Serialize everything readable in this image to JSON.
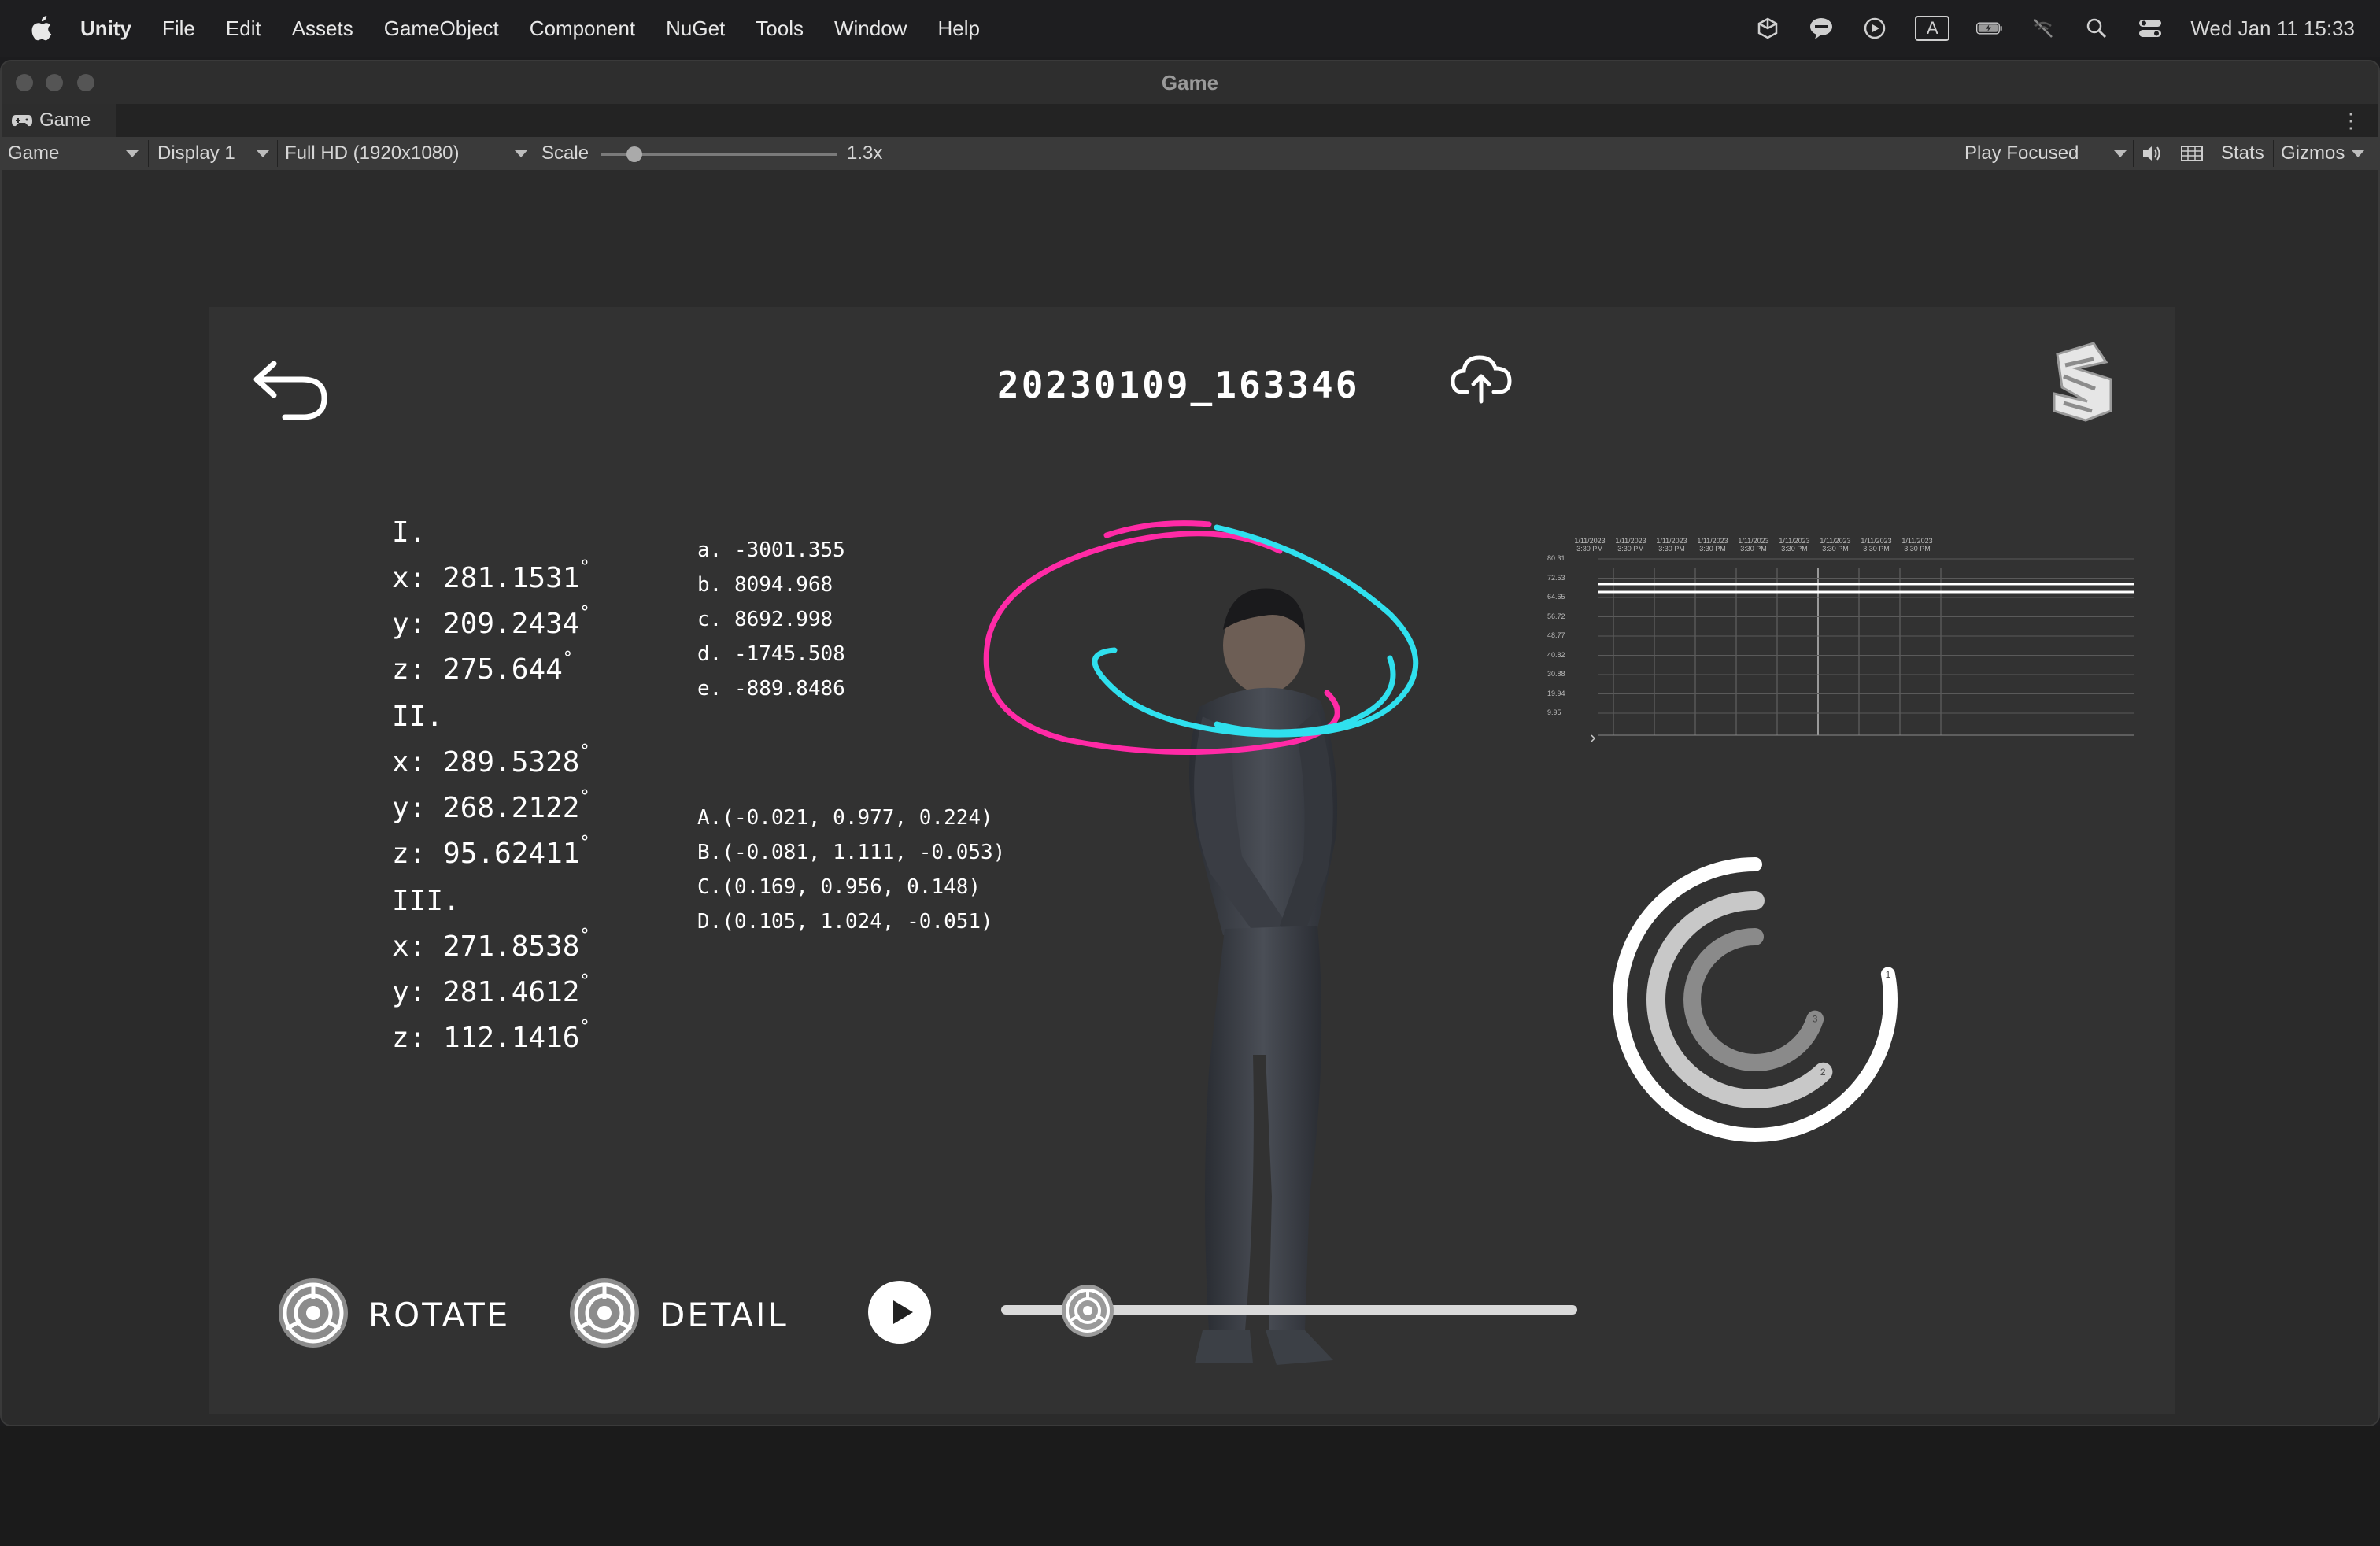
{
  "menubar": {
    "app_name": "Unity",
    "menus": [
      "File",
      "Edit",
      "Assets",
      "GameObject",
      "Component",
      "NuGet",
      "Tools",
      "Window",
      "Help"
    ],
    "clock": "Wed Jan 11  15:33",
    "input_badge": "A"
  },
  "window": {
    "title": "Game",
    "tab_label": "Game",
    "toolbar": {
      "view_dropdown": "Game",
      "display_dropdown": "Display 1",
      "resolution_dropdown": "Full HD (1920x1080)",
      "scale_label": "Scale",
      "scale_value": "1.3x",
      "scale_fraction": 0.07,
      "play_mode_dropdown": "Play Focused",
      "stats_label": "Stats",
      "gizmos_label": "Gizmos"
    }
  },
  "game": {
    "session_title": "20230109_163346",
    "angles": [
      {
        "section": "I.",
        "x": "x: 281.1531",
        "y": "y: 209.2434",
        "z": "z: 275.644"
      },
      {
        "section": "II.",
        "x": "x: 289.5328",
        "y": "y: 268.2122",
        "z": "z: 95.62411"
      },
      {
        "section": "III.",
        "x": "x: 271.8538",
        "y": "y: 281.4612",
        "z": "z: 112.1416"
      }
    ],
    "degree_symbol": "°",
    "coefficients": [
      "a. -3001.355",
      "b. 8094.968",
      "c. 8692.998",
      "d. -1745.508",
      "e. -889.8486"
    ],
    "points": [
      "A.(-0.021, 0.977, 0.224)",
      "B.(-0.081, 1.111, -0.053)",
      "C.(0.169, 0.956, 0.148)",
      "D.(0.105, 1.024, -0.051)"
    ],
    "rotate_label": "ROTATE",
    "detail_label": "DETAIL",
    "timeline_progress": 0.15,
    "mini_chart": {
      "x_labels": [
        "1/11/2023 3:30 PM",
        "1/11/2023 3:30 PM",
        "1/11/2023 3:30 PM",
        "1/11/2023 3:30 PM",
        "1/11/2023 3:30 PM",
        "1/11/2023 3:30 PM",
        "1/11/2023 3:30 PM",
        "1/11/2023 3:30 PM",
        "1/11/2023 3:30 PM"
      ],
      "y_labels": [
        "80.31",
        "72.53",
        "64.65",
        "56.72",
        "48.77",
        "40.82",
        "30.88",
        "19.94",
        "9.95"
      ]
    },
    "radial_gauge": {
      "rings": [
        {
          "label": "1",
          "fraction": 0.78,
          "color": "#ffffff"
        },
        {
          "label": "2",
          "fraction": 0.62,
          "color": "#c8c8c8"
        },
        {
          "label": "3",
          "fraction": 0.7,
          "color": "#8a8a8a"
        }
      ]
    },
    "trace_colors": {
      "magenta": "#ff2aa6",
      "cyan": "#2fe0ee"
    }
  }
}
